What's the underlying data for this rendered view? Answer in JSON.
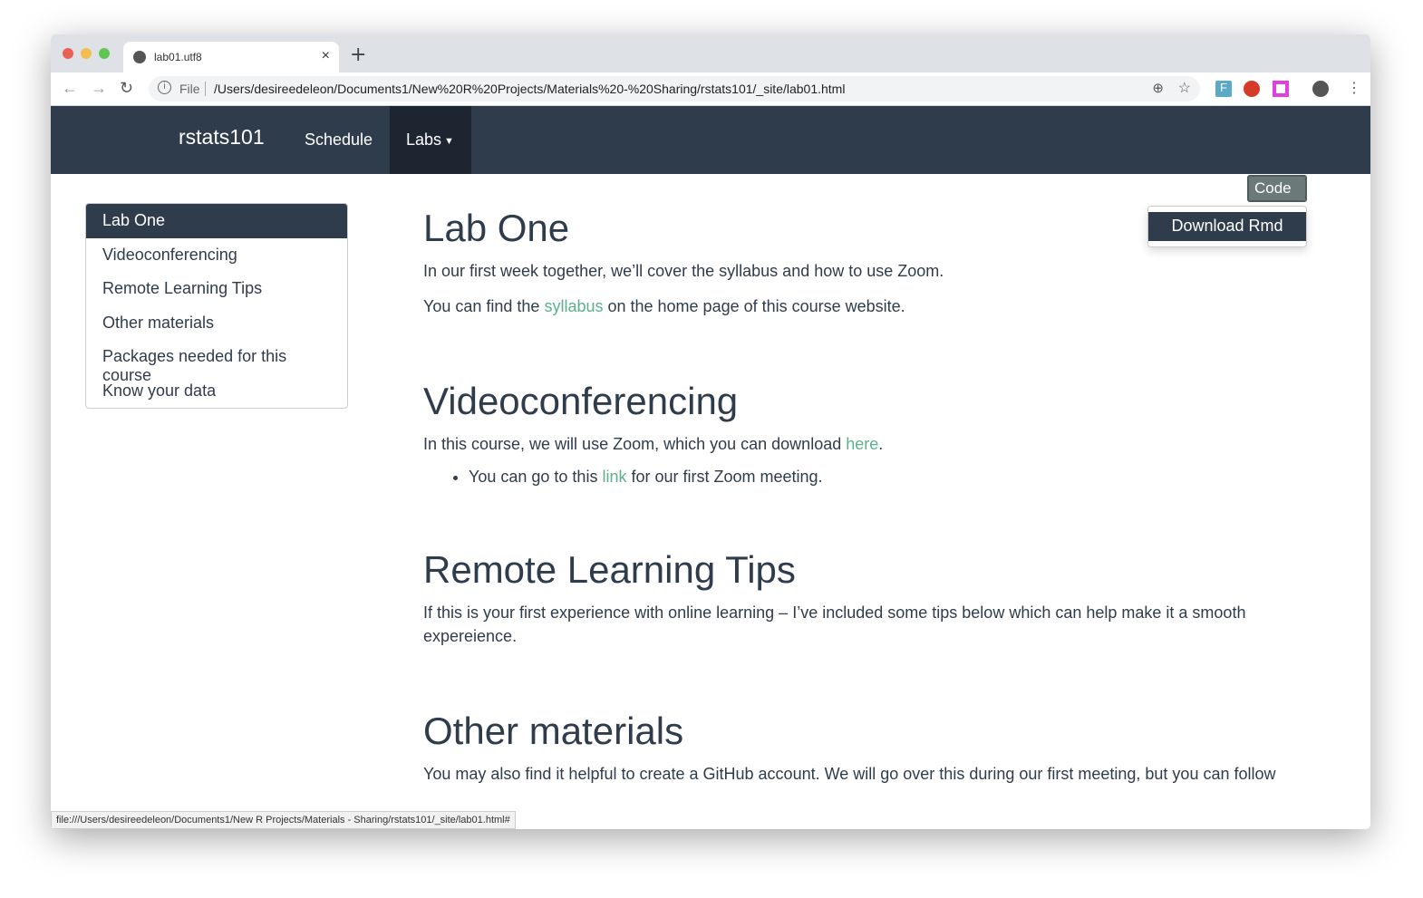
{
  "browser": {
    "tab_title": "lab01.utf8",
    "file_label": "File",
    "url": "/Users/desireedeleon/Documents1/New%20R%20Projects/Materials%20-%20Sharing/rstats101/_site/lab01.html",
    "status_url": "file:///Users/desireedeleon/Documents1/New R Projects/Materials - Sharing/rstats101/_site/lab01.html#"
  },
  "navbar": {
    "brand": "rstats101",
    "items": [
      "Schedule",
      "Labs"
    ]
  },
  "code_button": "Code",
  "code_menu": [
    "Download Rmd"
  ],
  "toc": [
    "Lab One",
    "Videoconferencing",
    "Remote Learning Tips",
    "Other materials",
    "Packages needed for this course",
    "Know your data"
  ],
  "sections": {
    "lab_one": {
      "title": "Lab One",
      "p1": "In our first week together, we’ll cover the syllabus and how to use Zoom.",
      "p2_pre": "You can find the ",
      "p2_link": "syllabus",
      "p2_post": " on the home page of this course website."
    },
    "video": {
      "title": "Videoconferencing",
      "p_pre": "In this course, we will use Zoom, which you can download ",
      "p_link": "here",
      "p_post": ".",
      "li_pre": "You can go to this ",
      "li_link": "link",
      "li_post": " for our first Zoom meeting."
    },
    "remote": {
      "title": "Remote Learning Tips",
      "p": "If this is your first experience with online learning – I’ve included some tips below which can help make it a smooth expereience."
    },
    "other": {
      "title": "Other materials",
      "p": "You may also find it helpful to create a GitHub account. We will go over this during our first meeting, but you can follow"
    }
  },
  "colors": {
    "navbar": "#2f3c4b",
    "link": "#5cb08e"
  }
}
